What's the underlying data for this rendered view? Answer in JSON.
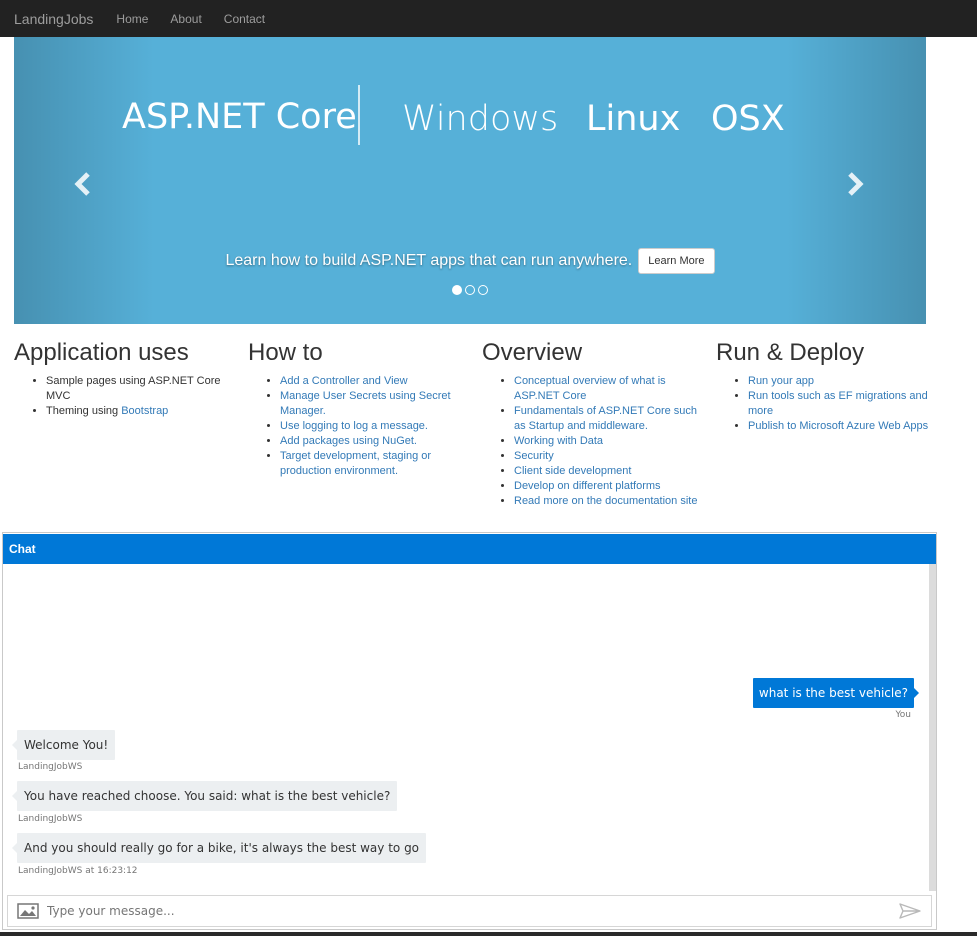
{
  "navbar": {
    "brand": "LandingJobs",
    "links": [
      "Home",
      "About",
      "Contact"
    ]
  },
  "carousel": {
    "banner": {
      "primary": "ASP.NET Core",
      "platforms": [
        "Windows",
        "Linux",
        "OSX"
      ]
    },
    "caption": "Learn how to build ASP.NET apps that can run anywhere.",
    "button_label": "Learn More",
    "slide_count": 3,
    "active_slide": 1,
    "prev_icon": "chevron-left-icon",
    "next_icon": "chevron-right-icon",
    "background_color": "#56b0d8"
  },
  "sections": [
    {
      "title": "Application uses",
      "items": [
        {
          "text": "Sample pages using ASP.NET Core MVC",
          "link": ""
        },
        {
          "text": "Theming using ",
          "link": "Bootstrap"
        }
      ]
    },
    {
      "title": "How to",
      "items": [
        {
          "text": "",
          "link": "Add a Controller and View"
        },
        {
          "text": "",
          "link": "Manage User Secrets using Secret Manager."
        },
        {
          "text": "",
          "link": "Use logging to log a message."
        },
        {
          "text": "",
          "link": "Add packages using NuGet."
        },
        {
          "text": "",
          "link": "Target development, staging or production environment."
        }
      ]
    },
    {
      "title": "Overview",
      "items": [
        {
          "text": "",
          "link": "Conceptual overview of what is ASP.NET Core"
        },
        {
          "text": "",
          "link": "Fundamentals of ASP.NET Core such as Startup and middleware."
        },
        {
          "text": "",
          "link": "Working with Data"
        },
        {
          "text": "",
          "link": "Security"
        },
        {
          "text": "",
          "link": "Client side development"
        },
        {
          "text": "",
          "link": "Develop on different platforms"
        },
        {
          "text": "",
          "link": "Read more on the documentation site"
        }
      ]
    },
    {
      "title": "Run & Deploy",
      "items": [
        {
          "text": "",
          "link": "Run your app"
        },
        {
          "text": "",
          "link": "Run tools such as EF migrations and more"
        },
        {
          "text": "",
          "link": "Publish to Microsoft Azure Web Apps"
        }
      ]
    }
  ],
  "chat": {
    "header": "Chat",
    "accent_color": "#0078d7",
    "messages": [
      {
        "from": "user",
        "text": "what is the best vehicle?",
        "meta": "You"
      },
      {
        "from": "bot",
        "text": "Welcome You!",
        "meta": "LandingJobWS"
      },
      {
        "from": "bot",
        "text": "You have reached choose. You said: what is the best vehicle?",
        "meta": "LandingJobWS"
      },
      {
        "from": "bot",
        "text": "And you should really go for a bike, it's always the best way to go",
        "meta": "LandingJobWS at 16:23:12"
      }
    ],
    "input_placeholder": "Type your message...",
    "upload_icon": "image-upload-icon",
    "send_icon": "send-icon"
  }
}
